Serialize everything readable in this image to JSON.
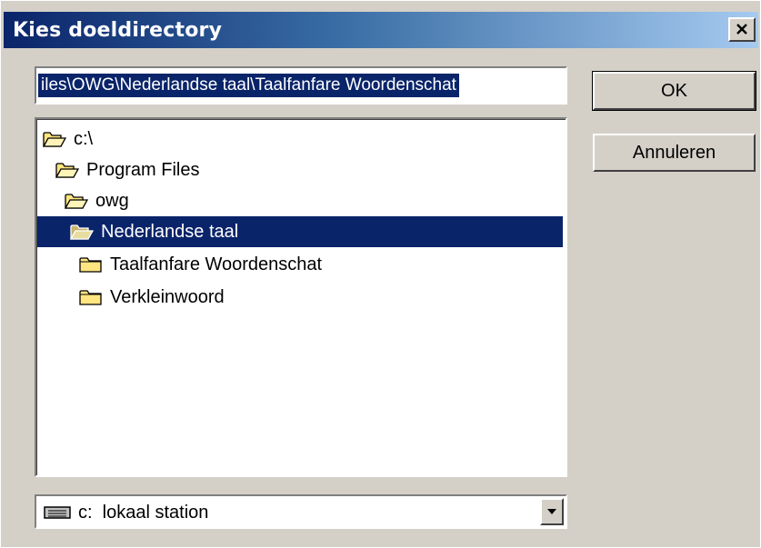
{
  "window": {
    "title": "Kies doeldirectory",
    "close_icon": "close-icon"
  },
  "path_field": {
    "value": "iles\\OWG\\Nederlandse taal\\Taalfanfare Woordenschat"
  },
  "buttons": {
    "ok_label": "OK",
    "cancel_label": "Annuleren"
  },
  "tree": {
    "items": [
      {
        "label": "c:\\",
        "icon": "folder-open-icon",
        "selected": false
      },
      {
        "label": "Program Files",
        "icon": "folder-open-icon",
        "selected": false
      },
      {
        "label": "owg",
        "icon": "folder-open-icon",
        "selected": false
      },
      {
        "label": "Nederlandse taal",
        "icon": "folder-open-icon",
        "selected": true
      },
      {
        "label": "Taalfanfare Woordenschat",
        "icon": "folder-icon",
        "selected": false
      },
      {
        "label": "Verkleinwoord",
        "icon": "folder-icon",
        "selected": false
      }
    ]
  },
  "drive": {
    "selected": "c:  lokaal station",
    "icon": "drive-icon"
  },
  "colors": {
    "selection": "#0a246a",
    "face": "#d4d0c8",
    "folder": "#ffe680"
  }
}
